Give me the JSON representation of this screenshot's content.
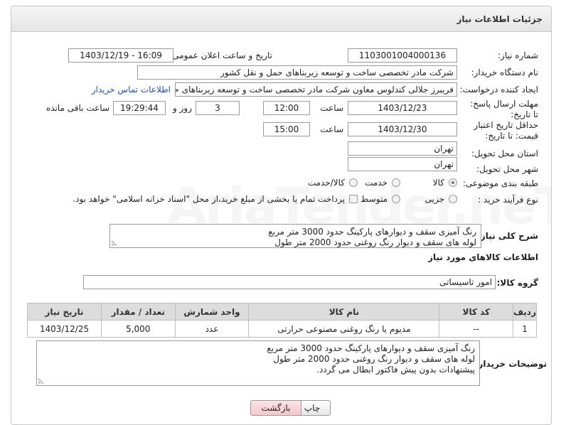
{
  "header": {
    "title": "جزئیات اطلاعات نیاز"
  },
  "fields": {
    "need_number_label": "شماره نیاز:",
    "need_number": "1103001004000136",
    "announce_label": "تاریخ و ساعت اعلان عمومی:",
    "announce_value": "1403/12/19 - 16:09",
    "buyer_org_label": "نام دستگاه خریدار:",
    "buyer_org": "شرکت مادر تخصصی ساخت و توسعه زیربناهای حمل و نقل کشور",
    "requester_label": "ایجاد کننده درخواست:",
    "requester": "فریبرز جلالی کندلوس معاون شرکت مادر تخصصی ساخت و توسعه زیربناهای حد",
    "contact_link": "اطلاعات تماس خریدار",
    "reply_deadline_label": "مهلت ارسال پاسخ: تا تاریخ:",
    "reply_date": "1403/12/23",
    "hour_label": "ساعت",
    "reply_time": "12:00",
    "days_value": "3",
    "days_label": "روز و",
    "remaining_time": "19:29:44",
    "remaining_label": "ساعت باقی مانده",
    "price_deadline_label": "حداقل تاریخ اعتبار قیمت: تا تاریخ:",
    "price_date": "1403/12/30",
    "price_hour_label": "ساعت",
    "price_time": "15:00",
    "province_label": "استان محل تحویل:",
    "province": "تهران",
    "city_label": "شهر محل تحویل:",
    "city": "تهران",
    "category_label": "طبقه بندی موضوعی:",
    "category_options": [
      "کالا",
      "خدمت",
      "کالا/خدمت"
    ],
    "category_selected": "کالا",
    "process_label": "نوع فرآیند خرید :",
    "process_options": [
      "جزیی",
      "متوسط"
    ],
    "payment_note": "پرداخت تمام یا بخشی از مبلغ خرید،از محل \"اسناد خزانه اسلامی\" خواهد بود."
  },
  "description": {
    "label": "شرح کلی نیاز:",
    "text": "رنگ آمیزی سقف و دیوارهای پارکینگ حدود 3000  متر مربع\nلوله های سقف و دیوار رنگ روغنی حدود 2000 متر طول"
  },
  "goods_section": {
    "title": "اطلاعات کالاهای مورد نیاز",
    "group_label": "گروه کالا:",
    "group_value": "امور تاسیساتی"
  },
  "table": {
    "headers": [
      "ردیف",
      "کد کالا",
      "نام کالا",
      "واحد شمارش",
      "تعداد / مقدار",
      "تاریخ نیاز"
    ],
    "rows": [
      [
        "1",
        "--",
        "مدیوم یا رنگ روغنی مصنوعی حرارتی",
        "عدد",
        "5,000",
        "1403/12/25"
      ]
    ]
  },
  "buyer_notes": {
    "label": "توضیحات خریدار:",
    "text": "رنگ آمیزی سقف و دیوارهای پارکینگ حدود 3000  متر مربع\nلوله های سقف و دیوار رنگ روغنی حدود 2000 متر طول\nپیشنهادات بدون پیش فاکتور ابطال می گردد."
  },
  "buttons": {
    "print": "چاپ",
    "back": "بازگشت"
  },
  "watermark": "AriaTender.neT",
  "colors": {
    "link": "#1a4fb8",
    "back_button": "#f3c7cc",
    "header_bg": "#e4e4e4"
  }
}
